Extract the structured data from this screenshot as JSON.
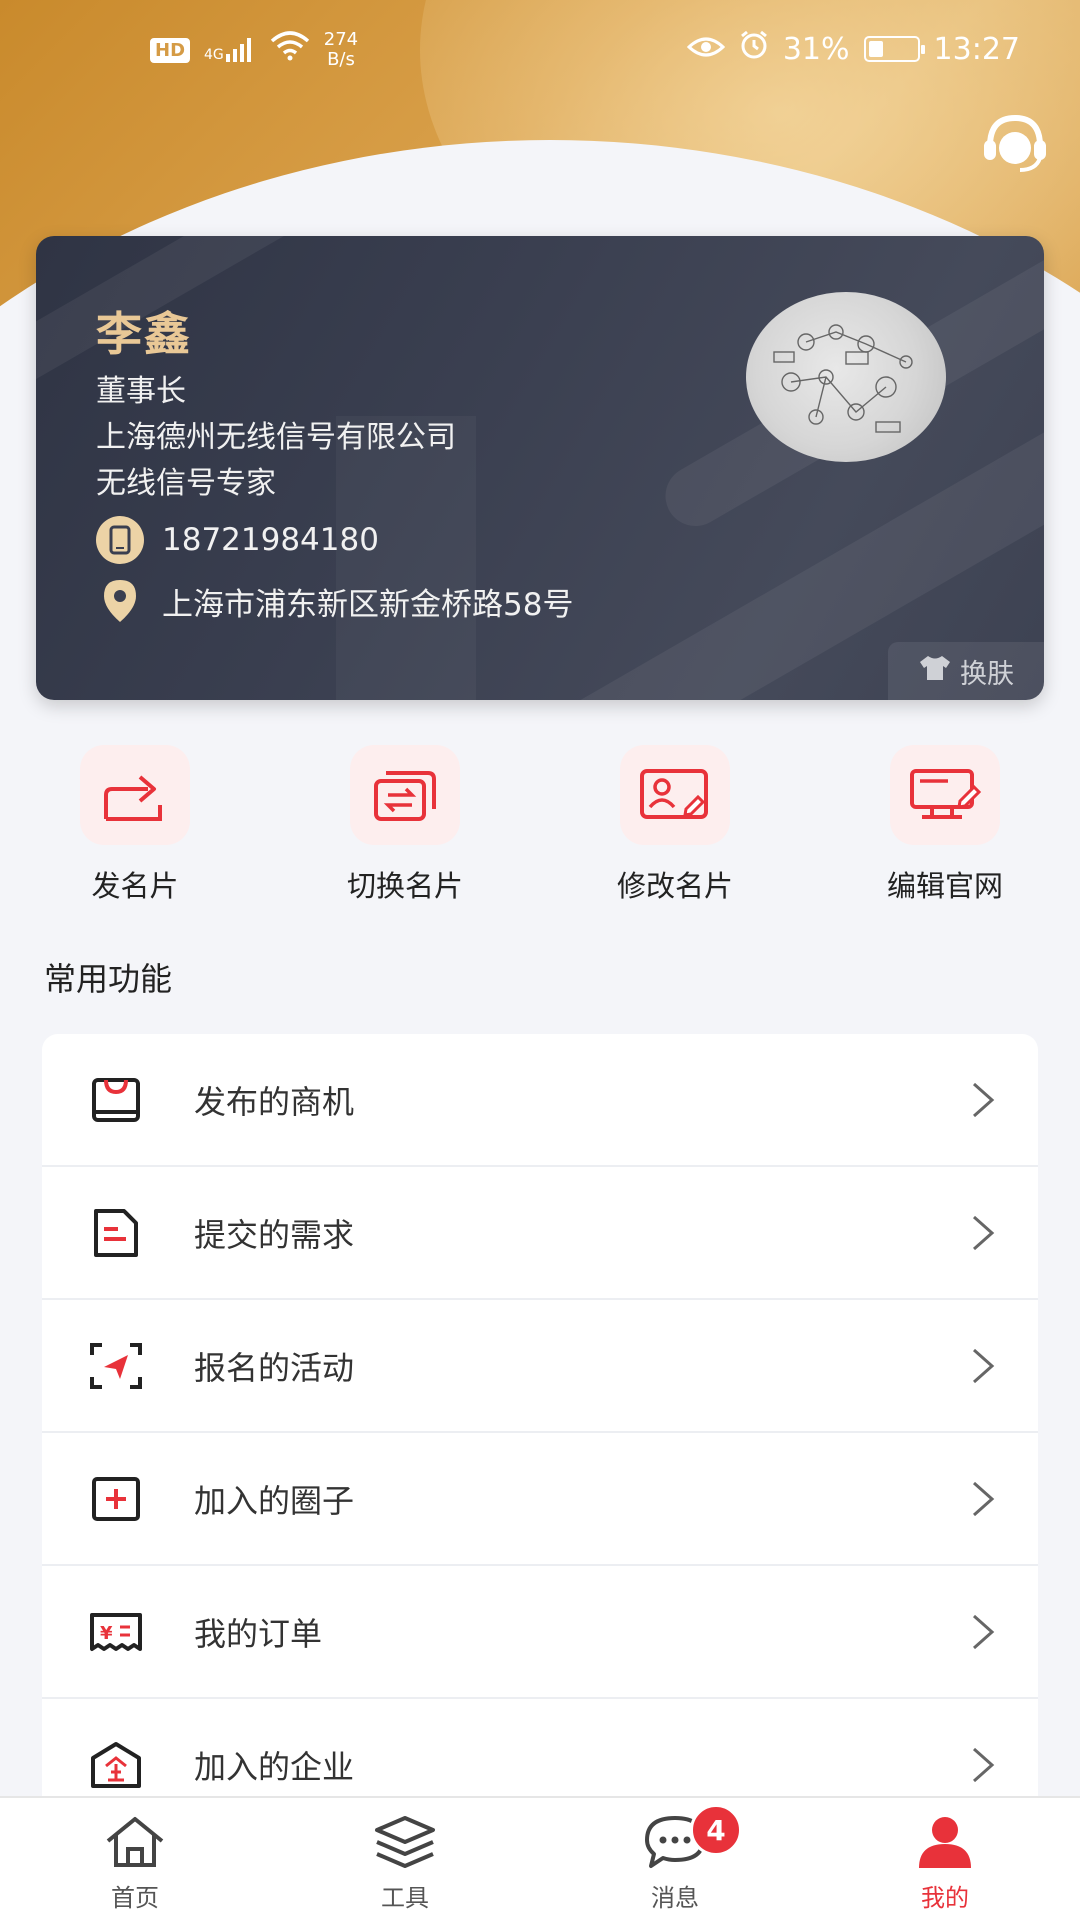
{
  "status_bar": {
    "hd": "HD",
    "network": "4G",
    "speed_value": "274",
    "speed_unit": "B/s",
    "battery_percent": "31%",
    "battery_level": 0.31,
    "time": "13:27"
  },
  "card": {
    "name": "李鑫",
    "title": "董事长",
    "company": "上海德州无线信号有限公司",
    "slogan": "无线信号专家",
    "phone": "18721984180",
    "address": "上海市浦东新区新金桥路58号",
    "skin_label": "换肤"
  },
  "quick_actions": [
    {
      "label": "发名片",
      "icon": "share-card-icon"
    },
    {
      "label": "切换名片",
      "icon": "switch-card-icon"
    },
    {
      "label": "修改名片",
      "icon": "edit-card-icon"
    },
    {
      "label": "编辑官网",
      "icon": "edit-website-icon"
    }
  ],
  "section_title": "常用功能",
  "menu": [
    {
      "label": "发布的商机",
      "icon": "bag-icon"
    },
    {
      "label": "提交的需求",
      "icon": "document-icon"
    },
    {
      "label": "报名的活动",
      "icon": "send-icon"
    },
    {
      "label": "加入的圈子",
      "icon": "plus-box-icon"
    },
    {
      "label": "我的订单",
      "icon": "ticket-icon"
    },
    {
      "label": "加入的企业",
      "icon": "company-icon"
    }
  ],
  "tabs": [
    {
      "label": "首页",
      "icon": "home-icon"
    },
    {
      "label": "工具",
      "icon": "layers-icon"
    },
    {
      "label": "消息",
      "icon": "chat-icon",
      "badge": "4"
    },
    {
      "label": "我的",
      "icon": "user-icon",
      "active": true
    }
  ],
  "colors": {
    "accent": "#e8323a",
    "gold": "#d59b45",
    "card_bg": "#3a3f50"
  }
}
